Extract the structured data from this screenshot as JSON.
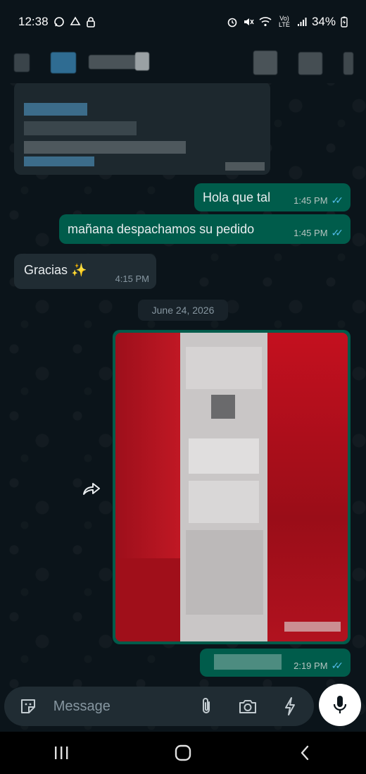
{
  "status_bar": {
    "time": "12:38",
    "battery": "34%",
    "network": "Vo) LTE"
  },
  "messages": [
    {
      "id": "m1",
      "direction": "outgoing",
      "text": "Hola que tal",
      "time": "1:45 PM",
      "status": "read"
    },
    {
      "id": "m2",
      "direction": "outgoing",
      "text": "mañana despachamos su pedido",
      "time": "1:45 PM",
      "status": "read"
    },
    {
      "id": "m3",
      "direction": "incoming",
      "text": "Gracias ✨",
      "time": "4:15 PM"
    },
    {
      "id": "m5",
      "direction": "outgoing",
      "type": "image",
      "time": "2:19 PM",
      "status": "read"
    }
  ],
  "date_separator": "June 24, 2026",
  "composer": {
    "placeholder": "Message"
  },
  "colors": {
    "background": "#0b141a",
    "outgoing_bubble": "#005c4b",
    "incoming_bubble": "#202c33",
    "read_ticks": "#53bdeb",
    "composer_bg": "#202c33"
  }
}
